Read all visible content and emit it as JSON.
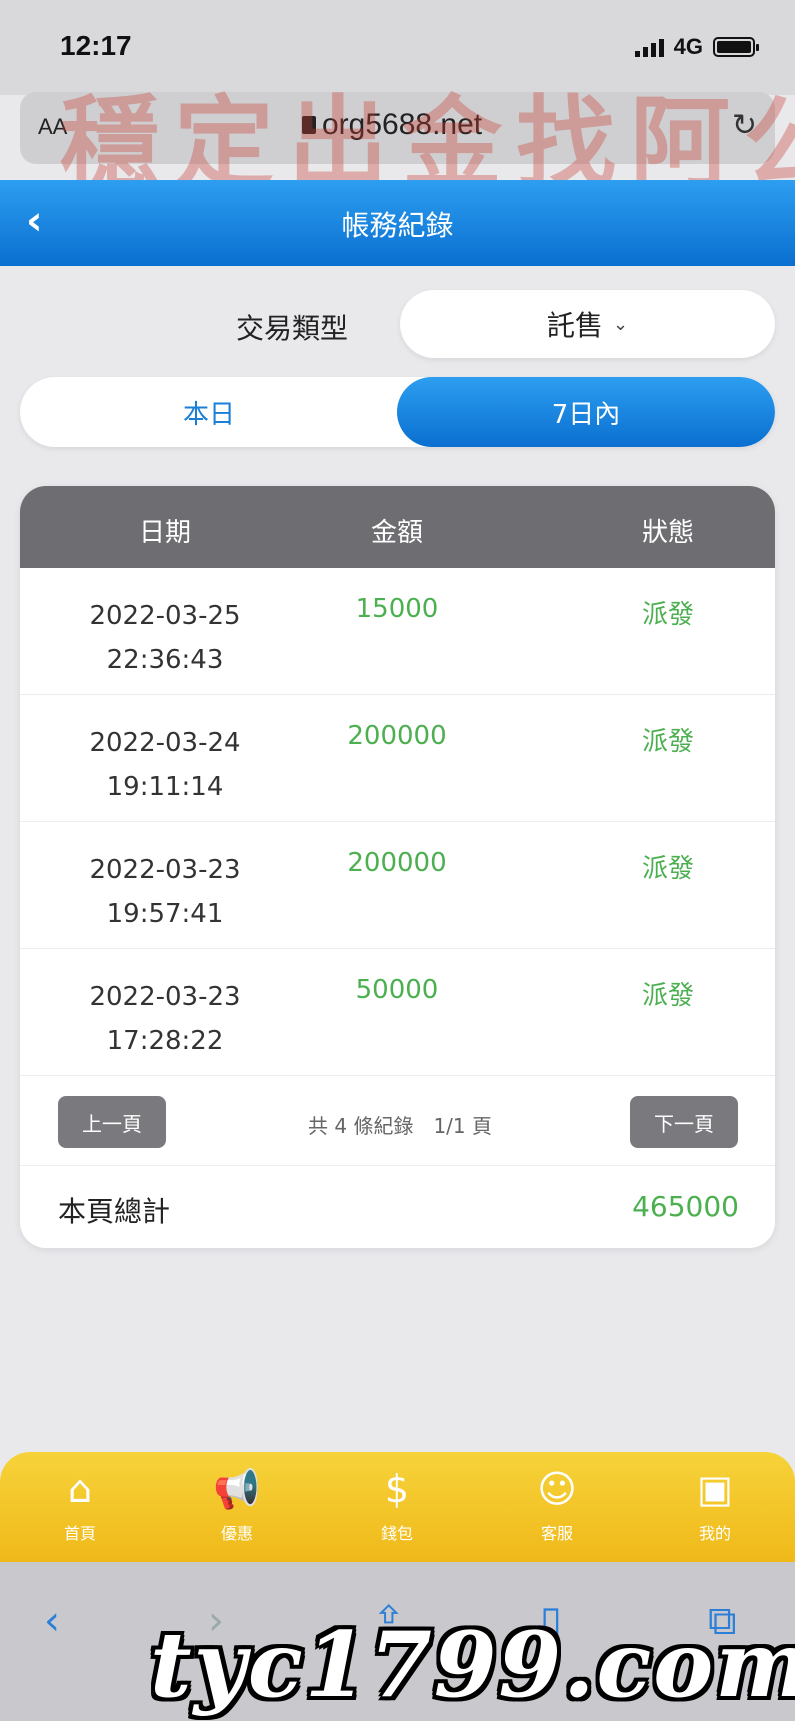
{
  "status_bar": {
    "time": "12:17",
    "network": "4G"
  },
  "browser": {
    "aa_label": "AA",
    "url": "org5688.net"
  },
  "watermark_top": "穩定出金找阿公",
  "header": {
    "back_icon": "chevron-left-icon",
    "title": "帳務紀錄"
  },
  "filter": {
    "label": "交易類型",
    "selected": "託售"
  },
  "segment": {
    "options": [
      "本日",
      "7日內"
    ],
    "active_index": 1
  },
  "table": {
    "headers": [
      "日期",
      "金額",
      "狀態"
    ],
    "rows": [
      {
        "date": "2022-03-25",
        "time": "22:36:43",
        "amount": "15000",
        "status": "派發"
      },
      {
        "date": "2022-03-24",
        "time": "19:11:14",
        "amount": "200000",
        "status": "派發"
      },
      {
        "date": "2022-03-23",
        "time": "19:57:41",
        "amount": "200000",
        "status": "派發"
      },
      {
        "date": "2022-03-23",
        "time": "17:28:22",
        "amount": "50000",
        "status": "派發"
      }
    ]
  },
  "pager": {
    "prev": "上一頁",
    "next": "下一頁",
    "info": "共 4 條紀錄　1/1 頁"
  },
  "total": {
    "label": "本頁總計",
    "value": "465000"
  },
  "tabbar": [
    {
      "icon": "home-icon",
      "label": "首頁"
    },
    {
      "icon": "megaphone-icon",
      "label": "優惠"
    },
    {
      "icon": "money-bag-icon",
      "label": "錢包"
    },
    {
      "icon": "support-agent-icon",
      "label": "客服"
    },
    {
      "icon": "profile-card-icon",
      "label": "我的"
    }
  ],
  "watermark_bottom": "tyc1799.com",
  "colors": {
    "primary_blue": "#0a6fd0",
    "green": "#4caf50",
    "tab_yellow": "#f0b91a",
    "header_gray": "#6e6e72"
  }
}
